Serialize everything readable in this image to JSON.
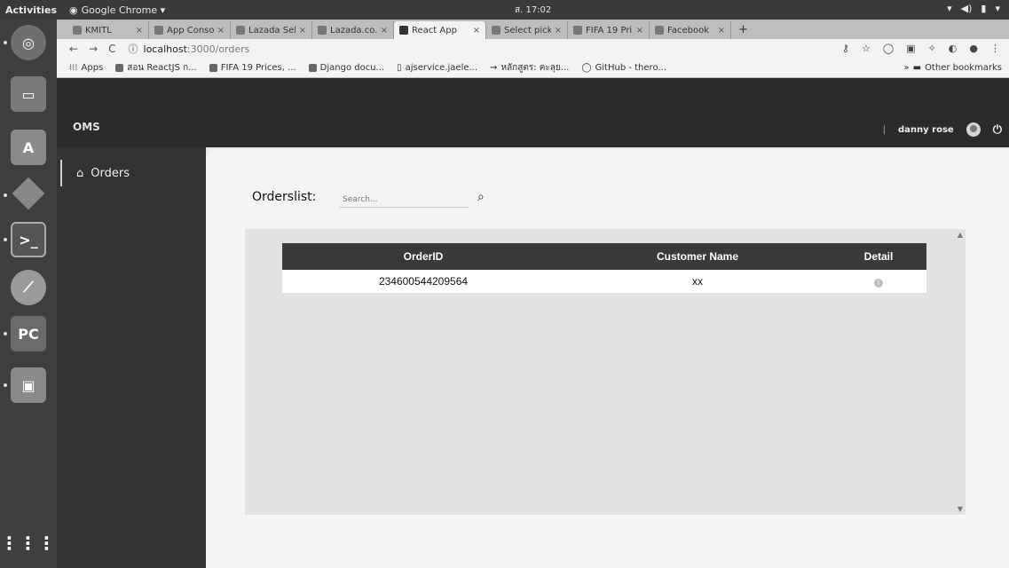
{
  "system_bar": {
    "activities": "Activities",
    "app_name": "Google Chrome ▾",
    "clock": "ส. 17:02"
  },
  "browser": {
    "tabs": [
      {
        "label": "KMITL",
        "active": false
      },
      {
        "label": "App Conso",
        "active": false
      },
      {
        "label": "Lazada Sell",
        "active": false
      },
      {
        "label": "Lazada.co.",
        "active": false
      },
      {
        "label": "React App",
        "active": true
      },
      {
        "label": "Select pick",
        "active": false
      },
      {
        "label": "FIFA 19 Pri",
        "active": false
      },
      {
        "label": "Facebook",
        "active": false
      }
    ],
    "url_host": "localhost",
    "url_path": ":3000/orders",
    "bookmarks": [
      "Apps",
      "สอน ReactJS ก...",
      "FIFA 19 Prices, ...",
      "Django docu...",
      "ajservice.jaele...",
      "หลักสูตร: คะลุย...",
      "GitHub - thero..."
    ],
    "other_bookmarks": "Other bookmarks"
  },
  "app": {
    "brand": "OMS",
    "nav": {
      "orders_label": "Orders"
    },
    "user": {
      "name": "danny rose"
    },
    "page": {
      "title": "Orderslist:",
      "search_placeholder": "Search..."
    },
    "table": {
      "headers": [
        "OrderID",
        "Customer Name",
        "Detail"
      ],
      "rows": [
        {
          "order_id": "234600544209564",
          "customer_name": "xx"
        }
      ]
    }
  }
}
